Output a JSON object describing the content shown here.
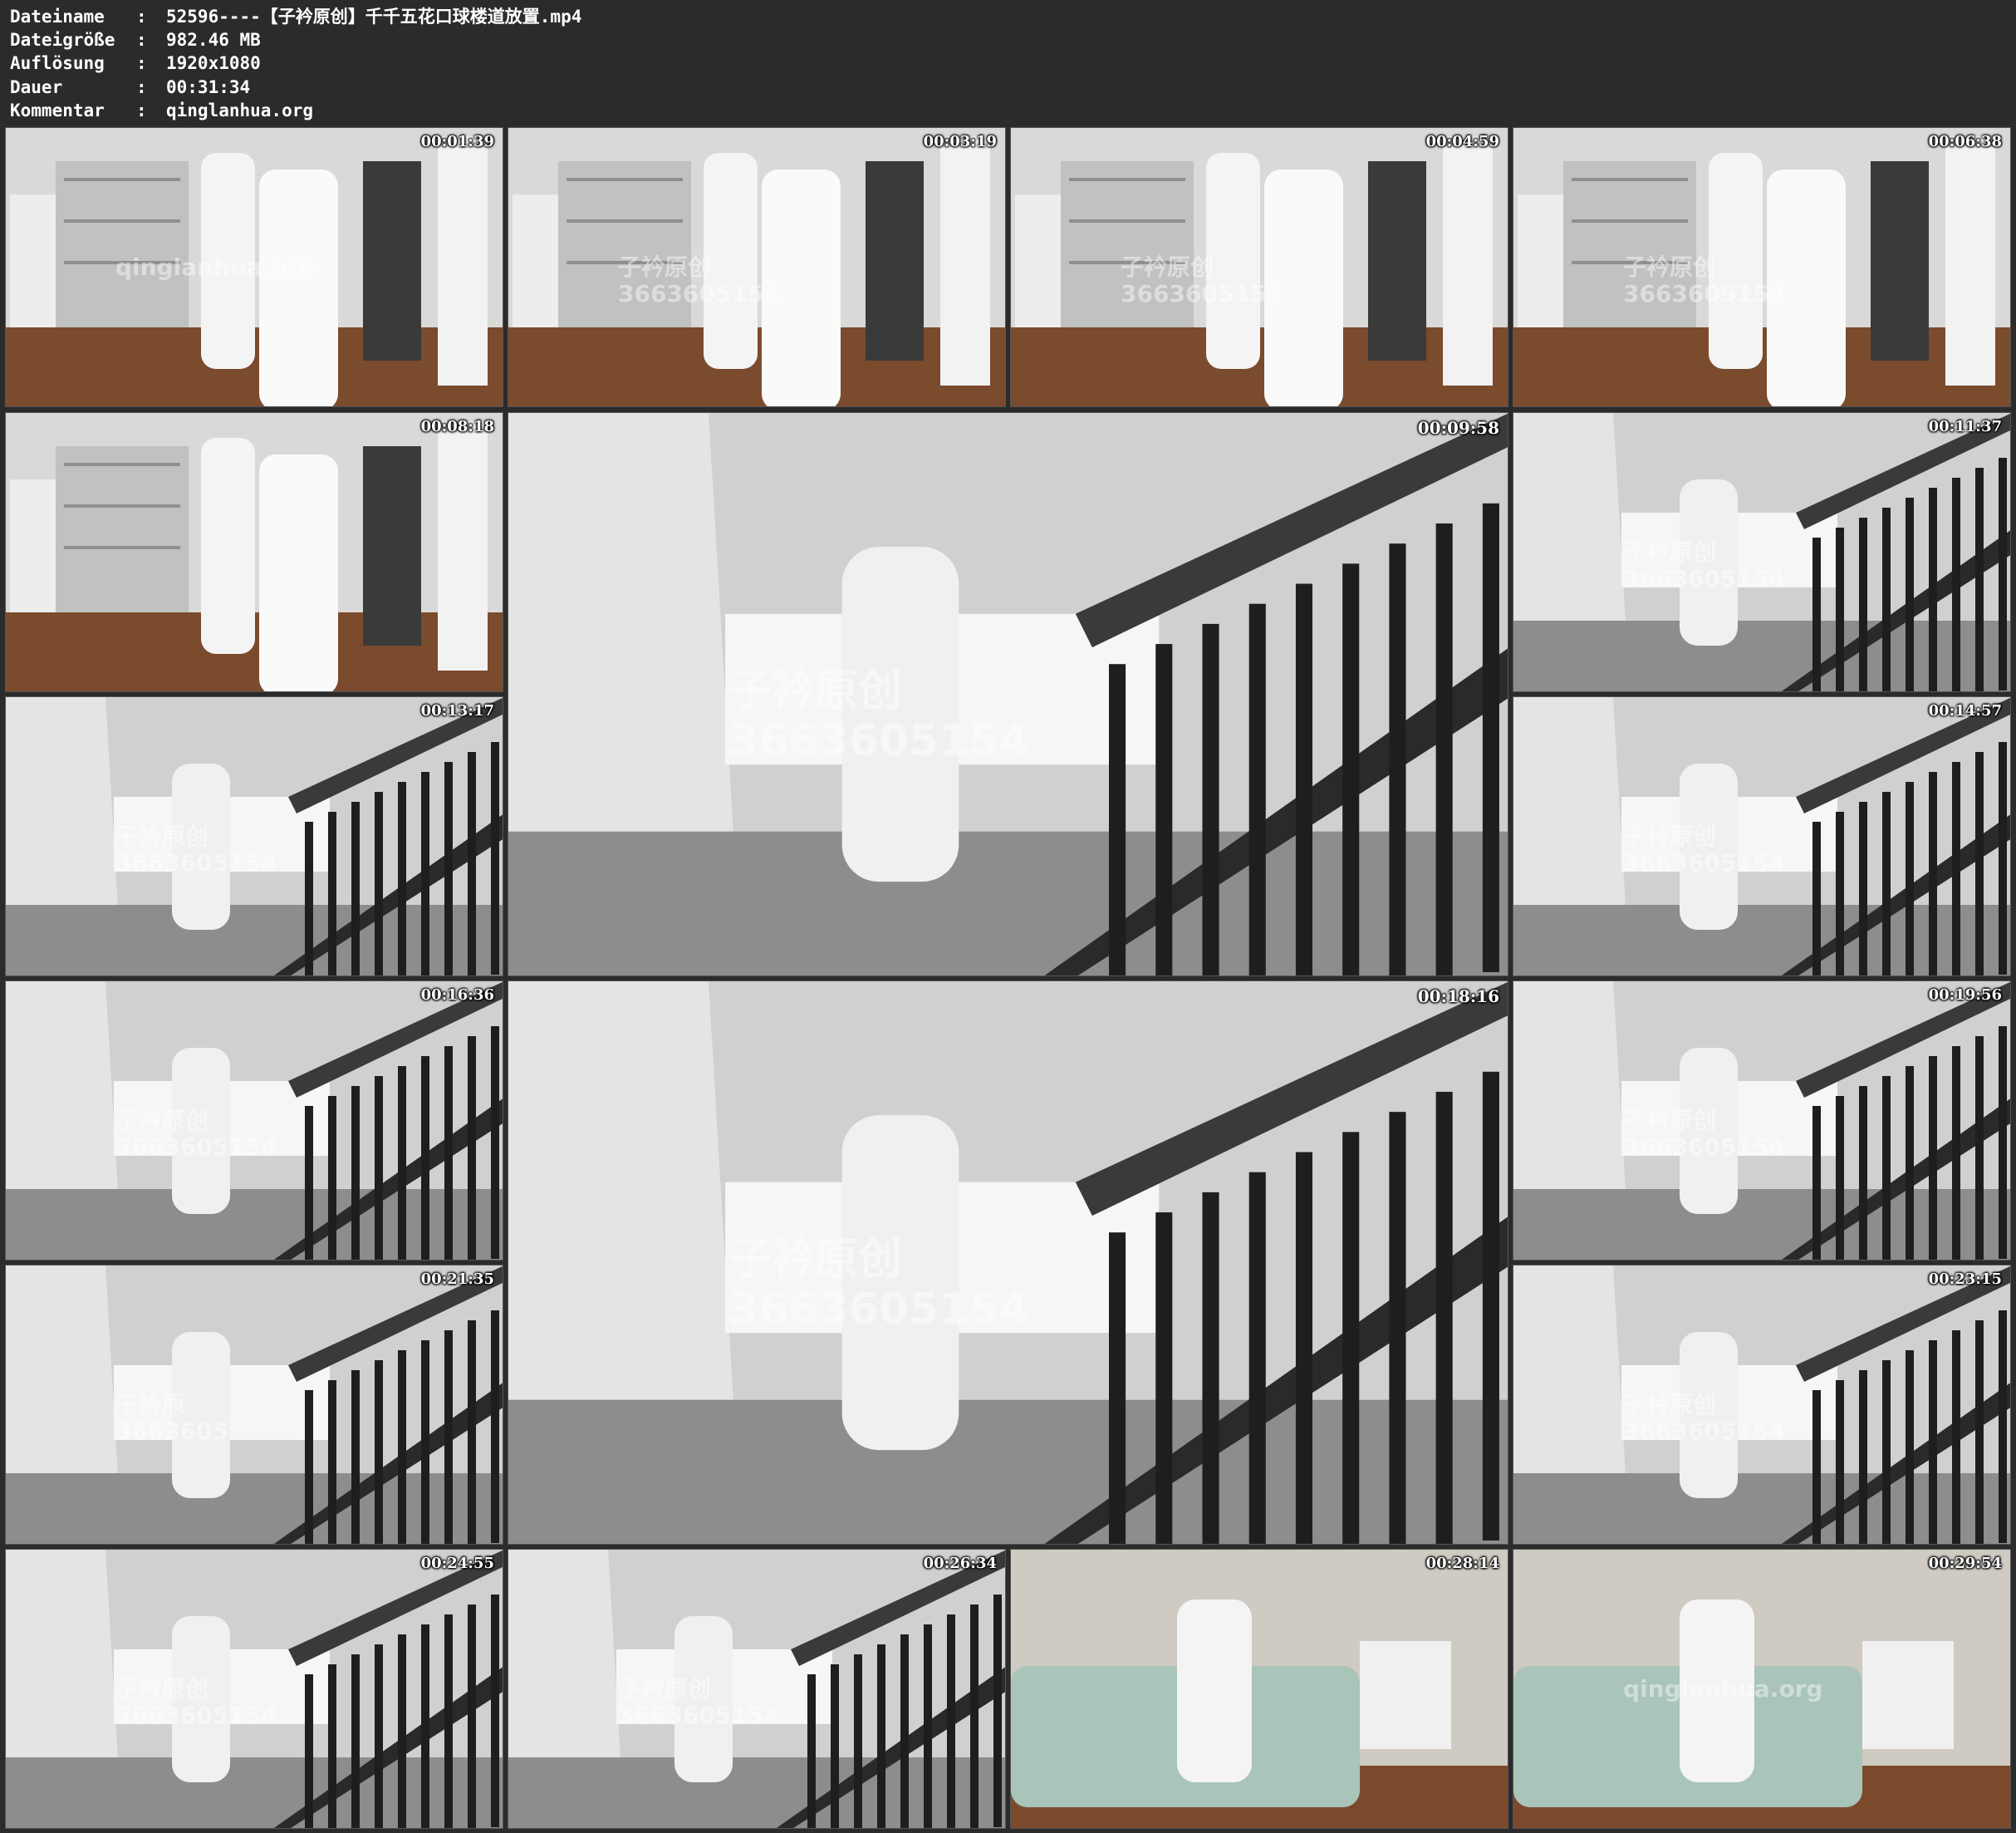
{
  "file_info": {
    "rows": [
      {
        "key": "Dateiname",
        "sep": ":",
        "value": "52596----【子衿原创】千千五花口球楼道放置.mp4"
      },
      {
        "key": "Dateigröße",
        "sep": ":",
        "value": "982.46 MB"
      },
      {
        "key": "Auflösung",
        "sep": ":",
        "value": "1920x1080"
      },
      {
        "key": "Dauer",
        "sep": ":",
        "value": "00:31:34"
      },
      {
        "key": "Kommentar",
        "sep": ":",
        "value": "qinglanhua.org"
      }
    ]
  },
  "thumbnails": [
    {
      "timestamp": "00:01:39",
      "scene": "room",
      "watermark": "qinglanhua.org"
    },
    {
      "timestamp": "00:03:19",
      "scene": "room",
      "watermark": "子衿原创\n3663605154"
    },
    {
      "timestamp": "00:04:59",
      "scene": "room",
      "watermark": "子衿原创\n3663605154"
    },
    {
      "timestamp": "00:06:38",
      "scene": "room",
      "watermark": "子衿原创\n3663605154"
    },
    {
      "timestamp": "00:08:18",
      "scene": "room",
      "watermark": ""
    },
    {
      "timestamp": "00:09:58",
      "scene": "stair",
      "watermark": "子衿原创\n3663605154"
    },
    {
      "timestamp": "00:11:37",
      "scene": "stair",
      "watermark": "子衿原创\n3663605154"
    },
    {
      "timestamp": "00:13:17",
      "scene": "stair",
      "watermark": "子衿原创\n3663605154"
    },
    {
      "timestamp": "00:14:57",
      "scene": "stair",
      "watermark": "子衿原创\n3663605154"
    },
    {
      "timestamp": "00:16:36",
      "scene": "stair",
      "watermark": "子衿原创\n3663605154"
    },
    {
      "timestamp": "00:18:16",
      "scene": "stair",
      "watermark": "子衿原创\n3663605154"
    },
    {
      "timestamp": "00:19:56",
      "scene": "stair",
      "watermark": "子衿原创\n3663605154"
    },
    {
      "timestamp": "00:21:35",
      "scene": "stair",
      "watermark": "子衿原\n3663605"
    },
    {
      "timestamp": "00:23:15",
      "scene": "stair",
      "watermark": "子衿原创\n3663605154"
    },
    {
      "timestamp": "00:24:55",
      "scene": "stair",
      "watermark": "子衿原创\n3663605154"
    },
    {
      "timestamp": "00:26:34",
      "scene": "stair",
      "watermark": "子衿原创\n3663605154"
    },
    {
      "timestamp": "00:28:14",
      "scene": "sofa",
      "watermark": ""
    },
    {
      "timestamp": "00:29:54",
      "scene": "sofa",
      "watermark": "qinglanhua.org"
    }
  ]
}
